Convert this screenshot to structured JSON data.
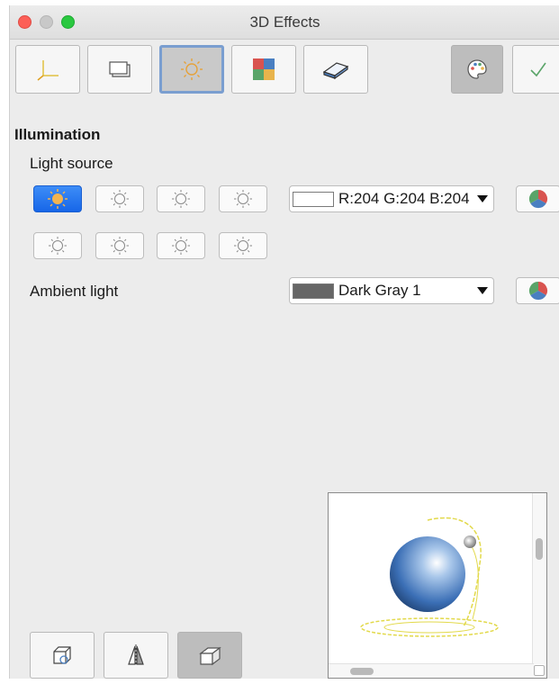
{
  "window": {
    "title": "3D Effects"
  },
  "toolbar": {
    "buttons": [
      {
        "icon": "geometry-axes-icon",
        "active": false
      },
      {
        "icon": "shading-icon",
        "active": false
      },
      {
        "icon": "illumination-icon",
        "active": true
      },
      {
        "icon": "textures-icon",
        "active": false
      },
      {
        "icon": "material-icon",
        "active": false
      }
    ],
    "right_buttons": [
      {
        "icon": "color-palette-icon",
        "pressed": true
      },
      {
        "icon": "apply-checkmark-icon",
        "pressed": false
      }
    ]
  },
  "illumination": {
    "heading": "Illumination",
    "light_source_label": "Light source",
    "light_sources": [
      {
        "on": true
      },
      {
        "on": false
      },
      {
        "on": false
      },
      {
        "on": false
      },
      {
        "on": false
      },
      {
        "on": false
      },
      {
        "on": false
      },
      {
        "on": false
      }
    ],
    "light_color": {
      "value": "R:204 G:204 B:204",
      "swatch": "#cccccc"
    },
    "ambient_label": "Ambient light",
    "ambient_color": {
      "value": "Dark Gray 1",
      "swatch": "#666666"
    }
  },
  "preview": {
    "sphere_color": "#3b6fb6",
    "lamp_color": "#e2d94a"
  },
  "bottom_buttons": [
    {
      "icon": "convert-to-3d-icon",
      "pressed": false
    },
    {
      "icon": "convert-to-rotation-object-icon",
      "pressed": false
    },
    {
      "icon": "perspective-on-off-icon",
      "pressed": true
    }
  ],
  "colors": {
    "accent": "#1766e8",
    "active_border": "#7a9ed0"
  }
}
